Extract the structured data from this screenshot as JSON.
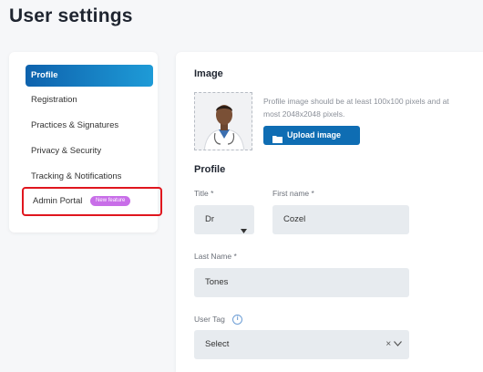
{
  "page": {
    "title": "User settings"
  },
  "sidebar": {
    "items": [
      {
        "label": "Profile",
        "active": true
      },
      {
        "label": "Registration"
      },
      {
        "label": "Practices & Signatures"
      },
      {
        "label": "Privacy & Security"
      },
      {
        "label": "Tracking & Notifications"
      },
      {
        "label": "Admin Portal",
        "badge": "New feature"
      }
    ]
  },
  "image_section": {
    "title": "Image",
    "hint": "Profile image should be at least 100x100 pixels and at most 2048x2048 pixels.",
    "upload_label": "Upload image"
  },
  "profile_section": {
    "title": "Profile",
    "title_field": {
      "label": "Title *",
      "value": "Dr"
    },
    "first_name": {
      "label": "First name *",
      "value": "Cozel"
    },
    "last_name": {
      "label": "Last Name *",
      "value": "Tones"
    },
    "user_tag": {
      "label": "User Tag",
      "placeholder": "Select"
    }
  },
  "colors": {
    "accent": "#0f6db3",
    "highlight": "#e0161e",
    "badge": "#c86ee8"
  }
}
